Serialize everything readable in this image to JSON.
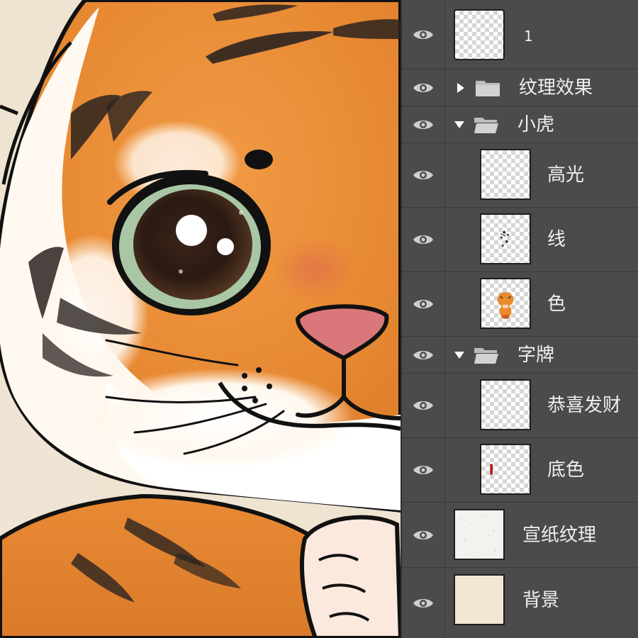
{
  "canvas": {
    "subject": "tiger-cub-illustration"
  },
  "layers_panel": {
    "layers": [
      {
        "id": "layer-1",
        "name": "1",
        "type": "layer",
        "visible": true,
        "thumbnail": "transparent"
      },
      {
        "id": "group-texture",
        "name": "纹理效果",
        "type": "group",
        "expanded": false,
        "visible": true
      },
      {
        "id": "group-tiger",
        "name": "小虎",
        "type": "group",
        "expanded": true,
        "visible": true
      },
      {
        "id": "layer-highlight",
        "name": "高光",
        "type": "layer",
        "visible": true,
        "thumbnail": "transparent",
        "indented": true
      },
      {
        "id": "layer-line",
        "name": "线",
        "type": "layer",
        "visible": true,
        "thumbnail": "line-art",
        "indented": true
      },
      {
        "id": "layer-color",
        "name": "色",
        "type": "layer",
        "visible": true,
        "thumbnail": "tiger-color",
        "indented": true
      },
      {
        "id": "group-sign",
        "name": "字牌",
        "type": "group",
        "expanded": true,
        "visible": true
      },
      {
        "id": "layer-text",
        "name": "恭喜发财",
        "type": "layer",
        "visible": true,
        "thumbnail": "transparent",
        "indented": true
      },
      {
        "id": "layer-basecolor",
        "name": "底色",
        "type": "layer",
        "visible": true,
        "thumbnail": "red-mark",
        "indented": true
      },
      {
        "id": "layer-paper",
        "name": "宣纸纹理",
        "type": "layer",
        "visible": true,
        "thumbnail": "paper-texture"
      },
      {
        "id": "layer-bg",
        "name": "背景",
        "type": "layer",
        "visible": true,
        "thumbnail": "beige-fill"
      }
    ]
  },
  "colors": {
    "panel_bg": "#4b4b4b",
    "panel_text": "#f0f0f0",
    "tiger_orange": "#e8892e",
    "eye_green": "#a9c7a5",
    "nose_pink": "#d9777a",
    "background_beige": "#f3e6d3"
  }
}
